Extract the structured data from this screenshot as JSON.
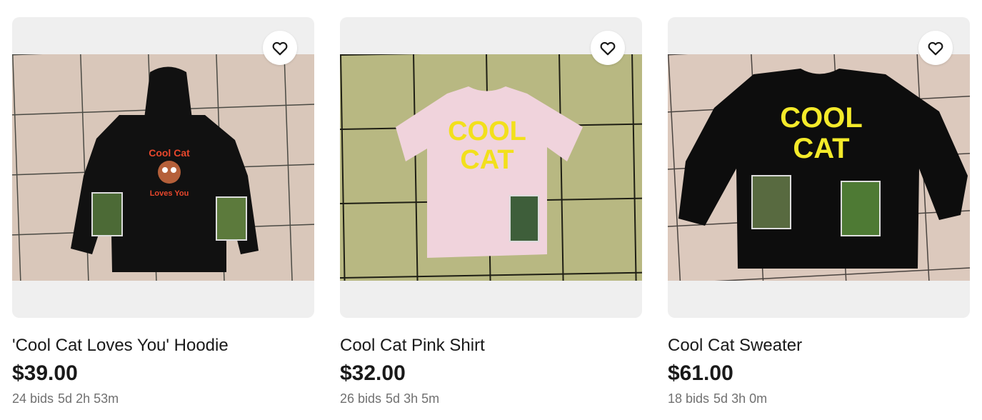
{
  "listings": [
    {
      "title": "'Cool Cat Loves You' Hoodie",
      "price": "$39.00",
      "bids": "24 bids",
      "time_left": "5d 2h 53m",
      "image": {
        "icon": "hoodie-photo",
        "garment_color": "#0f0f0f",
        "print_lines": [
          "Cool Cat",
          "Loves You"
        ],
        "print_color": "#e8472c"
      },
      "watch_icon": "heart-outline-icon"
    },
    {
      "title": "Cool Cat Pink Shirt",
      "price": "$32.00",
      "bids": "26 bids",
      "time_left": "5d 3h 5m",
      "image": {
        "icon": "tshirt-photo",
        "garment_color": "#f0d3dc",
        "print_lines": [
          "COOL",
          "CAT"
        ],
        "print_color": "#f2e01c"
      },
      "watch_icon": "heart-outline-icon"
    },
    {
      "title": "Cool Cat Sweater",
      "price": "$61.00",
      "bids": "18 bids",
      "time_left": "5d 3h 0m",
      "image": {
        "icon": "sweater-photo",
        "garment_color": "#0d0d0d",
        "print_lines": [
          "COOL",
          "CAT"
        ],
        "print_color": "#f4ea2a"
      },
      "watch_icon": "heart-outline-icon"
    }
  ]
}
